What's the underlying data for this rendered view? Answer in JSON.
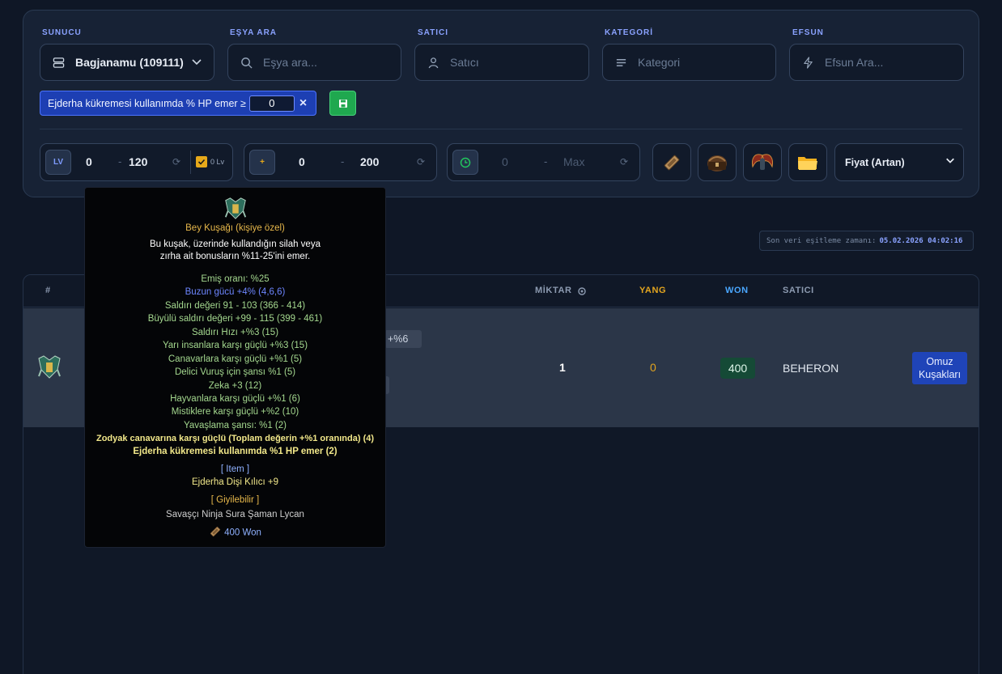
{
  "filters": {
    "server": {
      "label": "SUNUCU",
      "value": "Bagjanamu (109111)"
    },
    "item_search": {
      "label": "EŞYA ARA",
      "placeholder": "Eşya ara..."
    },
    "seller": {
      "label": "SATICI",
      "placeholder": "Satıcı"
    },
    "category": {
      "label": "KATEGORİ",
      "placeholder": "Kategori"
    },
    "bonus": {
      "label": "EFSUN",
      "placeholder": "Efsun Ara..."
    },
    "active_chip": {
      "text": "Ejderha kükremesi kullanımda % HP emer ≥",
      "value": "0",
      "remove": "×"
    },
    "level": {
      "badge": "LV",
      "min": "0",
      "max": "120",
      "zero_lv_label": "0 Lv",
      "zero_lv_checked": true
    },
    "plus": {
      "badge": "+",
      "min": "0",
      "max": "200"
    },
    "time": {
      "min": "0",
      "max": "Max"
    },
    "sort": {
      "value": "Fiyat (Artan)"
    }
  },
  "sync": {
    "label": "Son veri eşitleme zamanı:",
    "time": "05.02.2026 04:02:16"
  },
  "table": {
    "headers": {
      "index": "#",
      "quantity": "MİKTAR",
      "yang": "YANG",
      "won": "WON",
      "seller": "SATICI"
    },
    "rows": [
      {
        "quantity": "1",
        "yang": "0",
        "won": "400",
        "seller": "BEHERON",
        "category_line1": "Omuz",
        "category_line2": "Kuşakları",
        "peek_tag": "+%6"
      }
    ]
  },
  "tooltip": {
    "name": "Bey Kuşağı (kişiye özel)",
    "desc1": "Bu kuşak, üzerinde kullandığın silah veya",
    "desc2": "zırha ait bonusların %11-25'ini emer.",
    "absorb": "Emiş oranı: %25",
    "ice": "Buzun gücü +4% (4,6,6)",
    "attrs": [
      "Saldırı değeri 91 - 103 (366 - 414)",
      "Büyülü saldırı değeri +99 - 115 (399 - 461)",
      "Saldırı Hızı +%3 (15)",
      "Yarı insanlara karşı güçlü +%3 (15)",
      "Canavarlara karşı güçlü +%1 (5)",
      "Delici Vuruş için şansı %1 (5)",
      "Zeka +3 (12)",
      "Hayvanlara karşı güçlü +%1 (6)",
      "Mistiklere karşı güçlü +%2 (10)",
      "Yavaşlama şansı: %1 (2)"
    ],
    "special1": "Zodyak canavarına karşı güçlü (Toplam değerin +%1 oranında) (4)",
    "special2": "Ejderha kükremesi kullanımda %1 HP emer (2)",
    "item_header": "[ Item ]",
    "absorbed_item": "Ejderha Dişi Kılıcı +9",
    "wearable_header": "[ Giyilebilir ]",
    "classes": "Savaşçı Ninja Sura Şaman Lycan",
    "price": "400 Won"
  },
  "colors": {
    "accent": "#8aa2ff",
    "won_green": "#154a36",
    "yang": "#e3a51f",
    "won_header": "#4aa7ff"
  }
}
